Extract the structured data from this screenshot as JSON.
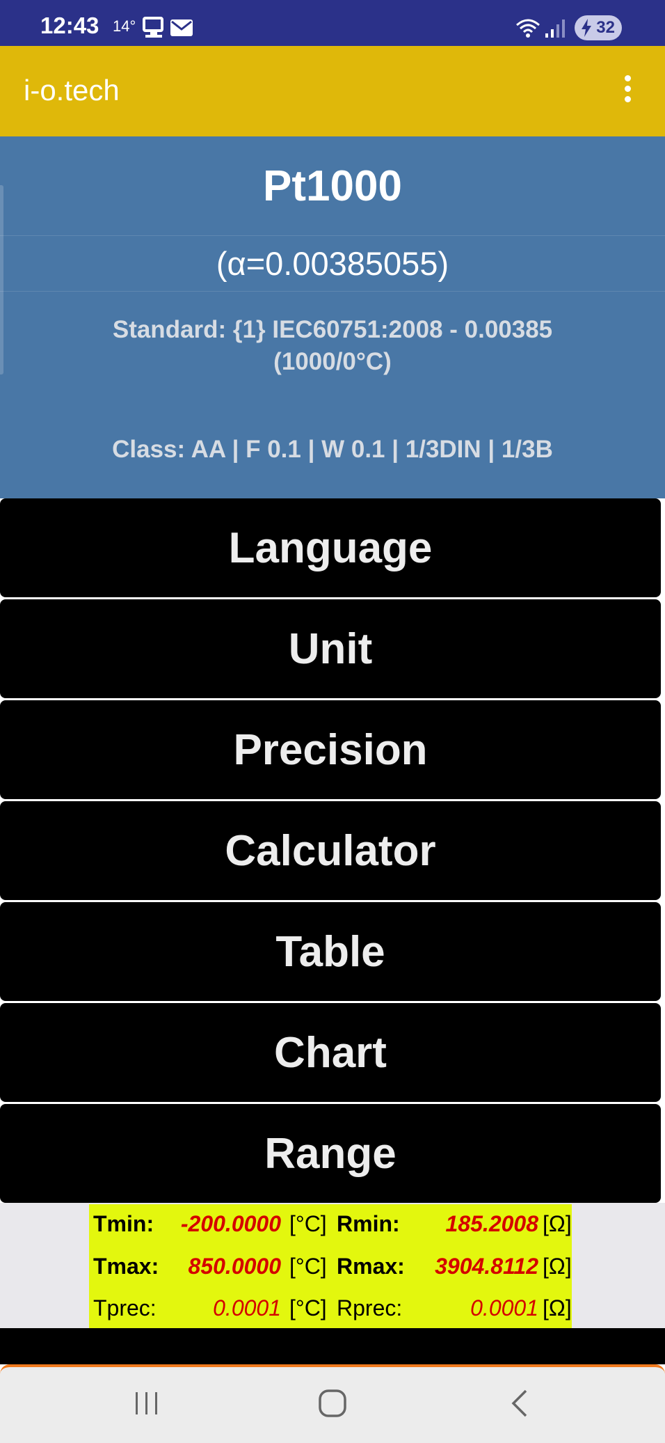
{
  "status_bar": {
    "time": "12:43",
    "temperature": "14°",
    "battery": "32",
    "icons": [
      "device-icon",
      "mail-icon",
      "wifi-icon",
      "signal-icon",
      "battery-charging-icon"
    ]
  },
  "app_bar": {
    "title": "i-o.tech",
    "menu_icon": "more-vert-icon"
  },
  "sensor": {
    "name": "Pt1000",
    "alpha": "(α=0.00385055)",
    "standard": "Standard: {1} IEC60751:2008 - 0.00385 (1000/0°C)",
    "class": "Class: AA | F 0.1 | W 0.1 | 1/3DIN | 1/3B"
  },
  "menu": {
    "items": [
      {
        "label": "Language"
      },
      {
        "label": "Unit"
      },
      {
        "label": "Precision"
      },
      {
        "label": "Calculator"
      },
      {
        "label": "Table"
      },
      {
        "label": "Chart"
      },
      {
        "label": "Range"
      }
    ]
  },
  "range": {
    "tmin_label": "Tmin:",
    "tmin_value": "-200.0000",
    "t_unit": "[°C]",
    "rmin_label": "Rmin:",
    "rmin_value": "185.2008",
    "r_unit": "[Ω]",
    "tmax_label": "Tmax:",
    "tmax_value": "850.0000",
    "rmax_label": "Rmax:",
    "rmax_value": "3904.8112",
    "tprec_label": "Tprec:",
    "tprec_value": "0.0001",
    "rprec_label": "Rprec:",
    "rprec_value": "0.0001"
  },
  "colors": {
    "status_bar": "#2b3189",
    "app_bar": "#dfb80a",
    "info_panel": "#4977a6",
    "menu_button": "#000000",
    "range_highlight": "#e3f70e",
    "value_text": "#d40000",
    "nav_accent": "#f07a1e"
  },
  "navigation": {
    "icons": [
      "recent-apps-icon",
      "home-icon",
      "back-icon"
    ]
  }
}
